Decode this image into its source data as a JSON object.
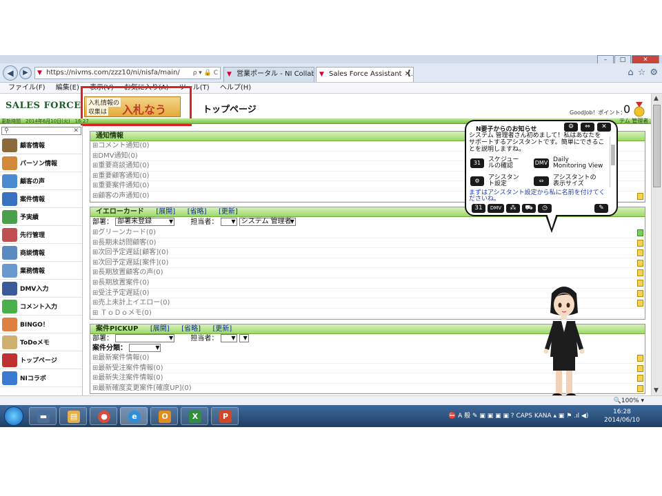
{
  "browser": {
    "url": "https://nivms.com/zzz10/ni/nisfa/main/",
    "url_tools": "ρ ▾ 🔒 C",
    "tabs": [
      {
        "label": "営業ポータル - NI Collabo 5...."
      },
      {
        "label": "Sales Force Assistant 【..."
      }
    ],
    "window_controls": {
      "minimize": "–",
      "maximize": "□",
      "close": "✕"
    },
    "menu": [
      "ファイル(F)",
      "編集(E)",
      "表示(V)",
      "お気に入り(A)",
      "ツール(T)",
      "ヘルプ(H)"
    ]
  },
  "header": {
    "logo": "SALES FORCE ASSISTANT",
    "banner_line1": "入札情報の",
    "banner_line2": "収集は",
    "banner_main": "入札なう",
    "page_title": "トップページ",
    "points_label": "GoodJob！ポイント：",
    "points_value": "0",
    "datetime": "更新時間　2014年6月10日(火)　16:27",
    "user": "テム 管理者"
  },
  "sidebar": {
    "search_placeholder": "",
    "items": [
      {
        "label": "顧客情報",
        "color": "#8a6a3a"
      },
      {
        "label": "パーソン情報",
        "color": "#d08a3a"
      },
      {
        "label": "顧客の声",
        "color": "#4a8ad0"
      },
      {
        "label": "案件情報",
        "color": "#3a70c0"
      },
      {
        "label": "予実績",
        "color": "#4aa04a"
      },
      {
        "label": "先行管理",
        "color": "#c05050"
      },
      {
        "label": "商談情報",
        "color": "#5a8ac0"
      },
      {
        "label": "業務情報",
        "color": "#6a9acd"
      },
      {
        "label": "DMV入力",
        "color": "#3a5a9a"
      },
      {
        "label": "コメント入力",
        "color": "#4ab04a"
      },
      {
        "label": "BINGO！",
        "color": "#e08040"
      },
      {
        "label": "ToDoメモ",
        "color": "#d0b070"
      },
      {
        "label": "トップページ",
        "color": "#c03030"
      },
      {
        "label": "NIコラボ",
        "color": "#3a7ad0"
      }
    ]
  },
  "notices": {
    "title": "通知情報",
    "rows": [
      "⊞コメント通知(0)",
      "⊞DMV通知(0)",
      "⊞重要商談通知(0)",
      "⊞重要顧客通知(0)",
      "⊞重要案件通知(0)",
      "⊞顧客の声通知(0)"
    ]
  },
  "yellow_card": {
    "title": "イエローカード",
    "links": [
      "[展開]",
      "[省略]",
      "[更新]"
    ],
    "dept_label": "部署：",
    "dept_value": "部署未登録",
    "owner_label": "担当者：",
    "owner_value": "システム 管理者",
    "rows": [
      "⊞グリーンカード(0)",
      "⊞長期未訪問顧客(0)",
      "⊞次回予定遅延[顧客](0)",
      "⊞次回予定遅延[案件](0)",
      "⊞長期放置顧客の声(0)",
      "⊞長期放置案件(0)",
      "⊞受注予定遅延(0)",
      "⊞売上未計上イエロー(0)",
      "⊞ ＴｏＤｏメモ(0)"
    ]
  },
  "pickup": {
    "title": "案件PICKUP",
    "links": [
      "[展開]",
      "[省略]",
      "[更新]"
    ],
    "dept_label": "部署：",
    "owner_label": "担当者：",
    "category_label": "案件分類：",
    "rows": [
      "⊞最新案件情報(0)",
      "⊞最新受注案件情報(0)",
      "⊞最新失注案件情報(0)",
      "⊞最新確度変更案件[確度UP](0)"
    ]
  },
  "assistant": {
    "title": "N要子からのお知らせ",
    "message": "システム 管理者さん初めまして！私はあなたをサポートするアシスタントです。簡単にできることを説明しますね。",
    "options": [
      {
        "icon": "31",
        "label": "スケジュー\nルの確認"
      },
      {
        "icon": "DMV",
        "label": "Daily\nMonitoring View"
      },
      {
        "icon": "⚙",
        "label": "アシスタン\nト設定"
      },
      {
        "icon": "⇔",
        "label": "アシスタントの\n表示サイズ"
      }
    ],
    "link": "まずはアシスタント設定から私に名前を付けてくださいね。",
    "bottom_icons": [
      "31",
      "DMV",
      "⁂",
      "⛟",
      "◷"
    ]
  },
  "status": {
    "zoom": "🔍100%  ▾"
  },
  "taskbar": {
    "apps": [
      "▬",
      "▤",
      "●",
      "e",
      "O",
      "X",
      "P"
    ],
    "tray": "⛔ A 般 ✎ ▣ ▣ ▣ ▣ ?  CAPS KANA  ▴ ▣ ⚑ .ıl ◀)",
    "time": "16:28",
    "date": "2014/06/10"
  }
}
